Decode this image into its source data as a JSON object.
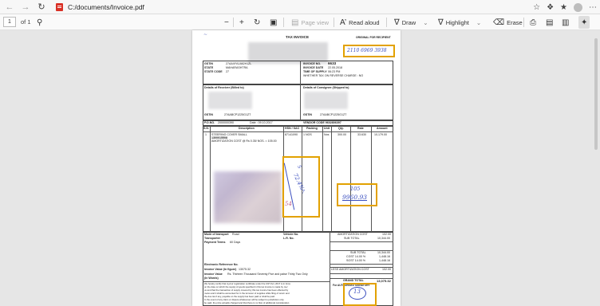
{
  "browser": {
    "url": "C:/documents/Invoice.pdf"
  },
  "toolbar": {
    "page_number": "1",
    "of_pages": "of 1",
    "zoom_out": "−",
    "zoom_in": "+",
    "page_view": "Page view",
    "read_aloud": "Read aloud",
    "draw": "Draw",
    "highlight": "Highlight",
    "erase": "Erase"
  },
  "invoice": {
    "title": "TAX INVOICE",
    "original_for_recipient": "ORIGINAL FOR RECIPIENT",
    "gstin_label": "GSTIN",
    "gstin_value": "27AAXFA1882H1ZL",
    "state_label": "STATE",
    "state_value": "MAHARASHTRA",
    "state_code_label": "STATE CODE",
    "state_code_value": "27",
    "invoice_no_label": "INVOICE NO.",
    "invoice_no_value": "6633",
    "invoice_date_label": "INVOICE DATE",
    "invoice_date_value": "22.05.2018",
    "time_of_supply_label": "TIME OF SUPPLY",
    "time_of_supply_value": "06:23 PM",
    "reverse_charge": "WHETHER TAX ON REVERSE CHARGE : NO",
    "receiver_label": "Details of Receiver (Billed to)",
    "consignee_label": "Details of Consignee (Shipped to)",
    "receiver_gstin": "27AABCP1225G1ZT",
    "consignee_gstin": "27AABCP1225G1ZT",
    "po_no_label": "P.O.NO.",
    "po_no_value": "2000000390",
    "po_date": "Date : 09.10.2017",
    "vendor_code": "VENDOR CODE 9602806397",
    "col_sn": "S.N.",
    "col_description": "Description",
    "col_hsn": "HSN / SAC",
    "col_packing": "Packing",
    "col_unit": "Unit",
    "col_qty": "Qty.",
    "col_rate": "Rate",
    "col_amount": "Amount",
    "item_sn": "1",
    "item_desc_1": "STEERING COVER SMALL",
    "item_desc_2": "1300015508",
    "item_desc_3": "AMORTIZATION COST @ Rs 0.35/ NOS. = 105.00",
    "item_hsn": "87141090",
    "item_packing": "1 NOS",
    "item_unit": "Nos",
    "item_qty": "300.00",
    "item_rate": "33.630",
    "item_amount": "10,179.00",
    "mode_transport_label": "Mode of transport",
    "mode_transport_value": "Road",
    "transporter_label": "Transporter",
    "vehicle_no_label": "Vehicle No.",
    "lr_no_label": "L.R. No.",
    "payment_terms_label": "Payment Terms",
    "payment_terms_value": "60 Days",
    "amortization_label": "AMORTIZATION COST",
    "amortization_value": "102.00",
    "subtotal_label_1": "SUB TOTAL",
    "subtotal_value_1": "10,344.00",
    "subtotal_label_2": "SUB TOTAL",
    "subtotal_value_2": "10,344.00",
    "cgst_label": "CGST 14.00 %",
    "cgst_value": "1,448.16",
    "sgst_label": "SGST 14.00 %",
    "sgst_value": "1,448.16",
    "less_amortization_label": "LESS AMORTIZATION COST",
    "less_amortization_value": "102.00",
    "grand_total_label": "GRAND TOTAL",
    "grand_total_value": "13,075.32",
    "ebill_label": "Electronic Reference No.",
    "invoice_value_fig_label": "Invoice Value (In figure)",
    "invoice_value_fig": "13075.32",
    "invoice_value_words_label": "Invoice Value",
    "invoice_value_words_label2": "(In Words)",
    "invoice_value_words": "Rs. Thirteen Thousand Seventy Five and paise Thirty Two Only",
    "authorised": "For AUTHORISED SIGNATORY",
    "fine_print_1": "We hereby certify that my/our registration certificate under the GST Act, 2017 is in force",
    "fine_print_2": "on the date on which the supply of goods specified in this tax invoice is made by me/",
    "fine_print_3": "us and that the transaction of supply covered by this tax invoice has been effected by",
    "fine_print_4": "me/us and it shall be accounted for in the turnover of supplies while filing of return and",
    "fine_print_5": "the due tax if any, payable on the supply has been paid or shall be paid.",
    "fine_print_6": "In the event of any claim or dispute whatsoever will be subject to jurisdiction only.",
    "fine_print_7": "be paid, the price actually charged and  that there is no flow of additional consideration"
  },
  "handwriting": {
    "top_number": "2110 6969 3938",
    "note_1": "105",
    "note_2": "9960.93",
    "mid_1": "5",
    "mid_2": "72.4%",
    "mid_3": "7",
    "mid_4": "54",
    "bottom": "13"
  },
  "colors": {
    "highlight_box": "#e2a100",
    "ink": "#3b4fbf"
  }
}
